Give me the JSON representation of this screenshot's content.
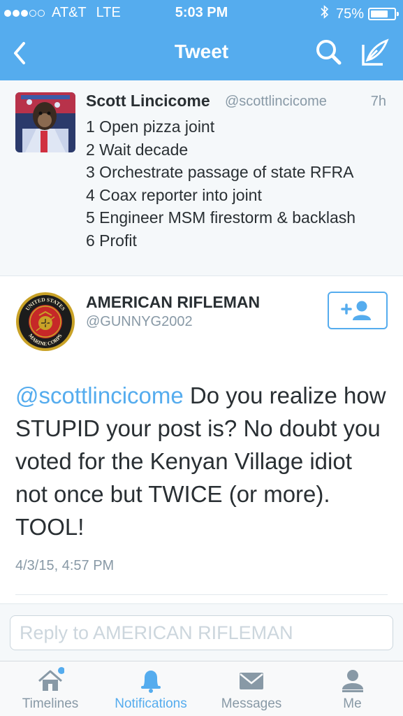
{
  "status_bar": {
    "carrier": "AT&T",
    "network": "LTE",
    "time": "5:03 PM",
    "battery_percent": "75%",
    "battery_level": 0.75,
    "signal_bars_filled": 3,
    "signal_bars_total": 5
  },
  "nav": {
    "title": "Tweet",
    "back_icon": "chevron-left-icon",
    "search_icon": "search-icon",
    "compose_icon": "compose-icon"
  },
  "quoted_tweet": {
    "name": "Scott Lincicome",
    "handle": "@scottlincicome",
    "time": "7h",
    "lines": [
      "1 Open pizza joint",
      "2 Wait decade",
      "3 Orchestrate passage of state RFRA",
      "4 Coax reporter into joint",
      "5 Engineer MSM firestorm & backlash",
      "6 Profit"
    ]
  },
  "main_tweet": {
    "name": "AMERICAN RIFLEMAN",
    "handle": "@GUNNYG2002",
    "follow_icon": "add-user-icon",
    "mention": "@scottlincicome",
    "text": " Do you realize how STUPID your post is? No doubt you voted for the Kenyan Village idiot not once but TWICE (or more). TOOL!",
    "date": "4/3/15, 4:57 PM",
    "avatar_text_top": "UNITED STATES",
    "avatar_text_bottom": "MARINE CORPS"
  },
  "reply": {
    "placeholder": "Reply to AMERICAN RIFLEMAN",
    "value": ""
  },
  "tabbar": {
    "items": [
      {
        "label": "Timelines",
        "icon": "home-icon",
        "active": false
      },
      {
        "label": "Notifications",
        "icon": "bell-icon",
        "active": true
      },
      {
        "label": "Messages",
        "icon": "envelope-icon",
        "active": false
      },
      {
        "label": "Me",
        "icon": "person-icon",
        "active": false
      }
    ]
  },
  "colors": {
    "accent": "#55acee",
    "text": "#292f33",
    "muted": "#8899a6"
  }
}
